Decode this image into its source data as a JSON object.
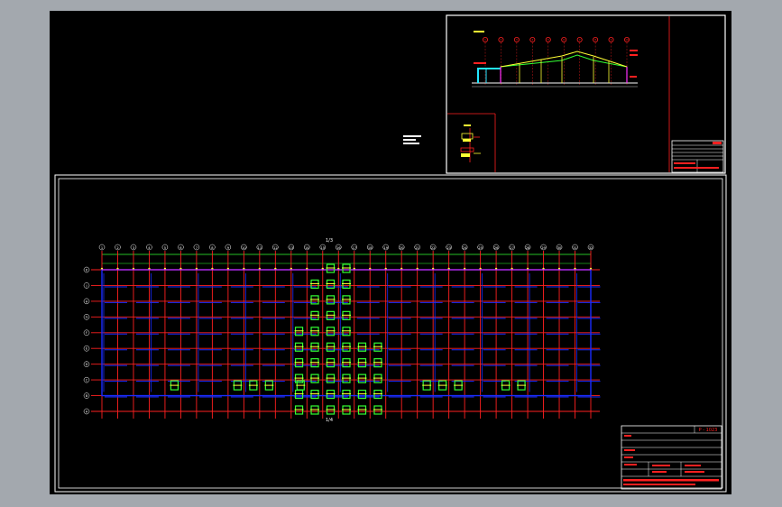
{
  "canvas": {
    "background": "#000000",
    "frame_color": "#a3a8ae"
  },
  "colors": {
    "grid_red": "#ff2020",
    "beam_blue": "#1a2cff",
    "column_magenta": "#ff30ff",
    "rebar_green": "#33ff33",
    "note_yellow": "#ffff33",
    "cyan": "#22e6ff",
    "white": "#ffffff"
  },
  "plan": {
    "columns": [
      "1",
      "2",
      "3",
      "4",
      "5",
      "6",
      "7",
      "8",
      "9",
      "10",
      "11",
      "12",
      "13",
      "14",
      "15",
      "16",
      "17",
      "18",
      "19",
      "20",
      "21",
      "22",
      "23",
      "24",
      "25",
      "26",
      "27",
      "28",
      "29",
      "30",
      "31",
      "32"
    ],
    "rows": [
      "K",
      "J",
      "H",
      "G",
      "F",
      "E",
      "D",
      "C",
      "B",
      "A"
    ],
    "top_dimension_label": "1/3",
    "bottom_dimension_label": "1/4"
  },
  "elevation": {
    "axis_labels": [
      "1",
      "2",
      "3",
      "4",
      "5",
      "6",
      "7",
      "8",
      "9",
      "10"
    ]
  },
  "title_block": {
    "drawing_number": "P - 1023"
  }
}
